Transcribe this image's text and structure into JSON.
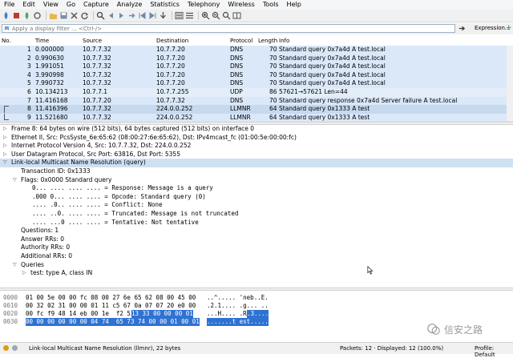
{
  "menu": [
    "File",
    "Edit",
    "View",
    "Go",
    "Capture",
    "Analyze",
    "Statistics",
    "Telephony",
    "Wireless",
    "Tools",
    "Help"
  ],
  "filter": {
    "placeholder": "Apply a display filter ... <Ctrl-/>",
    "expression_label": "Expression...",
    "add_label": "+"
  },
  "columns": {
    "no": "No.",
    "time": "Time",
    "source": "Source",
    "destination": "Destination",
    "protocol": "Protocol",
    "length": "Length",
    "info": "Info"
  },
  "packets": [
    {
      "no": "1",
      "time": "0.000000",
      "source": "10.7.7.32",
      "destination": "10.7.7.20",
      "protocol": "DNS",
      "length": "70",
      "info": "Standard query 0x7a4d A test.local"
    },
    {
      "no": "2",
      "time": "0.990630",
      "source": "10.7.7.32",
      "destination": "10.7.7.20",
      "protocol": "DNS",
      "length": "70",
      "info": "Standard query 0x7a4d A test.local"
    },
    {
      "no": "3",
      "time": "1.991051",
      "source": "10.7.7.32",
      "destination": "10.7.7.20",
      "protocol": "DNS",
      "length": "70",
      "info": "Standard query 0x7a4d A test.local"
    },
    {
      "no": "4",
      "time": "3.990998",
      "source": "10.7.7.32",
      "destination": "10.7.7.20",
      "protocol": "DNS",
      "length": "70",
      "info": "Standard query 0x7a4d A test.local"
    },
    {
      "no": "5",
      "time": "7.990732",
      "source": "10.7.7.32",
      "destination": "10.7.7.20",
      "protocol": "DNS",
      "length": "70",
      "info": "Standard query 0x7a4d A test.local"
    },
    {
      "no": "6",
      "time": "10.134213",
      "source": "10.7.7.1",
      "destination": "10.7.7.255",
      "protocol": "UDP",
      "length": "86",
      "info": "57621→57621 Len=44"
    },
    {
      "no": "7",
      "time": "11.416168",
      "source": "10.7.7.20",
      "destination": "10.7.7.32",
      "protocol": "DNS",
      "length": "70",
      "info": "Standard query response 0x7a4d Server failure A test.local"
    },
    {
      "no": "8",
      "time": "11.416396",
      "source": "10.7.7.32",
      "destination": "224.0.0.252",
      "protocol": "LLMNR",
      "length": "64",
      "info": "Standard query 0x1333 A test"
    },
    {
      "no": "9",
      "time": "11.521680",
      "source": "10.7.7.32",
      "destination": "224.0.0.252",
      "protocol": "LLMNR",
      "length": "64",
      "info": "Standard query 0x1333 A test"
    }
  ],
  "details": [
    {
      "arrow": "▷",
      "indent": 0,
      "text": "Frame 8: 64 bytes on wire (512 bits), 64 bytes captured (512 bits) on interface 0"
    },
    {
      "arrow": "▷",
      "indent": 0,
      "text": "Ethernet II, Src: PcsSyste_6e:65:62 (08:00:27:6e:65:62), Dst: IPv4mcast_fc (01:00:5e:00:00:fc)"
    },
    {
      "arrow": "▷",
      "indent": 0,
      "text": "Internet Protocol Version 4, Src: 10.7.7.32, Dst: 224.0.0.252"
    },
    {
      "arrow": "▷",
      "indent": 0,
      "text": "User Datagram Protocol, Src Port: 63816, Dst Port: 5355"
    },
    {
      "arrow": "▽",
      "indent": 0,
      "text": "Link-local Multicast Name Resolution (query)",
      "highlight": true
    },
    {
      "arrow": "",
      "indent": 1,
      "text": "Transaction ID: 0x1333"
    },
    {
      "arrow": "▽",
      "indent": 1,
      "text": "Flags: 0x0000 Standard query"
    },
    {
      "arrow": "",
      "indent": 2,
      "text": "0... .... .... .... = Response: Message is a query"
    },
    {
      "arrow": "",
      "indent": 2,
      "text": ".000 0... .... .... = Opcode: Standard query (0)"
    },
    {
      "arrow": "",
      "indent": 2,
      "text": ".... .0.. .... .... = Conflict: None"
    },
    {
      "arrow": "",
      "indent": 2,
      "text": ".... ..0. .... .... = Truncated: Message is not truncated"
    },
    {
      "arrow": "",
      "indent": 2,
      "text": ".... ...0 .... .... = Tentative: Not tentative"
    },
    {
      "arrow": "",
      "indent": 1,
      "text": "Questions: 1"
    },
    {
      "arrow": "",
      "indent": 1,
      "text": "Answer RRs: 0"
    },
    {
      "arrow": "",
      "indent": 1,
      "text": "Authority RRs: 0"
    },
    {
      "arrow": "",
      "indent": 1,
      "text": "Additional RRs: 0"
    },
    {
      "arrow": "▽",
      "indent": 1,
      "text": "Queries"
    },
    {
      "arrow": "▷",
      "indent": 2,
      "text": "test: type A, class IN"
    }
  ],
  "hex": [
    {
      "offset": "0000",
      "bytes_plain": "01 00 5e 00 00 fc 08 00  27 6e 65 62 08 00 45 00",
      "bytes_sel": "",
      "ascii_plain": "..^..... 'neb..E.",
      "ascii_sel": ""
    },
    {
      "offset": "0010",
      "bytes_plain": "00 32 02 31 00 00 01 11  c5 67 0a 07 07 20 e0 00",
      "bytes_sel": "",
      "ascii_plain": ".2.1.... .g... ..",
      "ascii_sel": ""
    },
    {
      "offset": "0020",
      "bytes_plain": "00 fc f9 48 14 eb 00 1e  f2 52 ",
      "bytes_sel": "13 33 00 00 00 01",
      "ascii_plain": "...H.... .R",
      "ascii_sel": ".3...."
    },
    {
      "offset": "0030",
      "bytes_plain": "",
      "bytes_sel": "00 00 00 00 00 00 04 74  65 73 74 00 00 01 00 01",
      "ascii_plain": "",
      "ascii_sel": ".......t est....."
    }
  ],
  "watermark": "信安之路",
  "status": {
    "left": "Link-local Multicast Name Resolution (llmnr), 22 bytes",
    "packets": "Packets: 12 · Displayed: 12 (100.0%)",
    "profile": "Profile: Default"
  },
  "colors": {
    "row_bg": "#dae8f9",
    "selection": "#2e72d2",
    "highlight": "#cfe0f3"
  }
}
